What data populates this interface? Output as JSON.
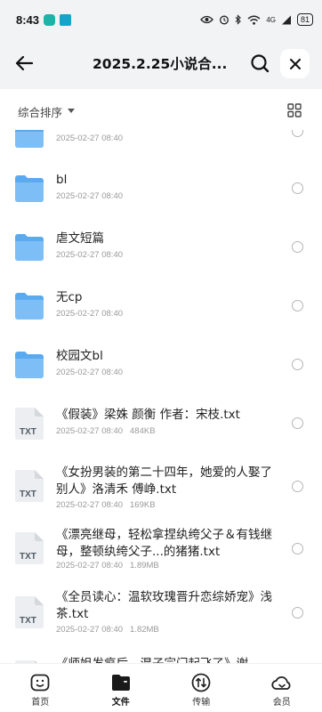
{
  "status_bar": {
    "time": "8:43",
    "battery": "81",
    "net_label": "4G"
  },
  "header": {
    "title": "2025.2.25小说合..."
  },
  "sort": {
    "label": "综合排序"
  },
  "files": [
    {
      "type": "folder",
      "name": "",
      "date": "2025-02-27 08:40",
      "size": ""
    },
    {
      "type": "folder",
      "name": "bl",
      "date": "2025-02-27 08:40",
      "size": ""
    },
    {
      "type": "folder",
      "name": "虐文短篇",
      "date": "2025-02-27 08:40",
      "size": ""
    },
    {
      "type": "folder",
      "name": "无cp",
      "date": "2025-02-27 08:40",
      "size": ""
    },
    {
      "type": "folder",
      "name": "校园文bl",
      "date": "2025-02-27 08:40",
      "size": ""
    },
    {
      "type": "txt",
      "name": "《假装》梁姝 颜衡 作者：宋枝.txt",
      "date": "2025-02-27 08:40",
      "size": "484KB"
    },
    {
      "type": "txt",
      "name": "《女扮男装的第二十四年，她爱的人娶了别人》洛清禾 傅峥.txt",
      "date": "2025-02-27 08:40",
      "size": "169KB"
    },
    {
      "type": "txt",
      "name": "《漂亮继母，轻松拿捏纨绔父子＆有钱继母，整顿纨绔父子...的猪猪.txt",
      "date": "2025-02-27 08:40",
      "size": "1.89MB"
    },
    {
      "type": "txt",
      "name": "《全员读心：温软玫瑰晋升恋综娇宠》浅茶.txt",
      "date": "2025-02-27 08:40",
      "size": "1.82MB"
    },
    {
      "type": "txt",
      "name": "《师姐发疯后，混子宗门起飞了》谢",
      "date": "",
      "size": ""
    }
  ],
  "icons": {
    "txt_label": "TXT"
  },
  "nav": [
    {
      "label": "首页",
      "icon": "home-icon"
    },
    {
      "label": "文件",
      "icon": "folder-icon"
    },
    {
      "label": "传输",
      "icon": "transfer-icon"
    },
    {
      "label": "会员",
      "icon": "cloud-icon"
    }
  ],
  "colors": {
    "folder": "#5aaaf0",
    "background": "#f2f3f5",
    "text": "#222222"
  }
}
